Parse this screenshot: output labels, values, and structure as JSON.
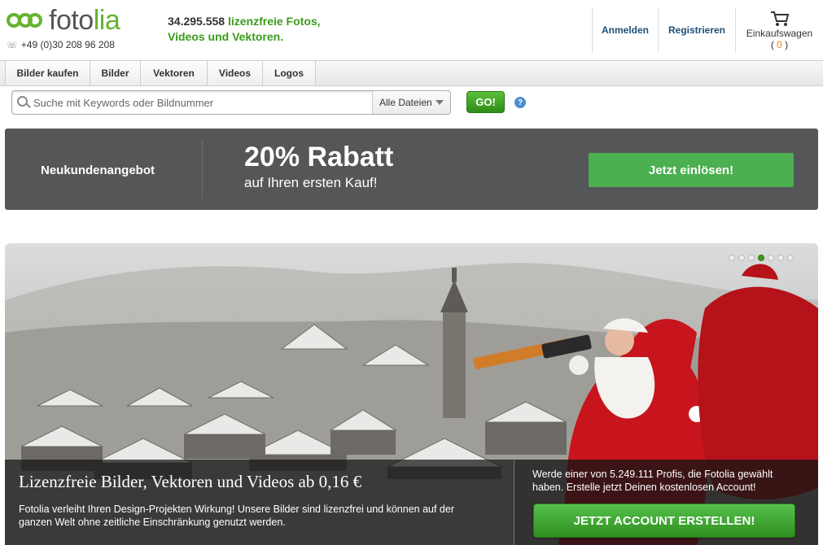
{
  "header": {
    "logo_part1": "foto",
    "logo_part2": "lia",
    "phone": "+49 (0)30 208 96 208",
    "tagline_count": "34.295.558",
    "tagline_line1_rest": "lizenzfreie Fotos,",
    "tagline_line2": "Videos und Vektoren.",
    "login": "Anmelden",
    "register": "Registrieren",
    "cart_label": "Einkaufswagen",
    "cart_count": "0"
  },
  "nav": {
    "tabs": [
      "Bilder kaufen",
      "Bilder",
      "Vektoren",
      "Videos",
      "Logos"
    ]
  },
  "search": {
    "placeholder": "Suche mit Keywords oder Bildnummer",
    "filter_selected": "Alle Dateien",
    "go_label": "GO!",
    "help_label": "?"
  },
  "promo": {
    "label": "Neukundenangebot",
    "headline": "20% Rabatt",
    "subline": "auf Ihren ersten Kauf!",
    "button": "Jetzt einlösen!"
  },
  "hero": {
    "slide_count": 7,
    "active_slide": 4,
    "title": "Lizenzfreie Bilder, Vektoren und Videos ab 0,16 €",
    "text": "Fotolia verleiht Ihren Design-Projekten Wirkung! Unsere Bilder sind lizenzfrei und können auf der ganzen Welt ohne zeitliche Einschränkung genutzt werden.",
    "signup_text": "Werde einer von 5.249.111 Profis, die Fotolia gewählt haben. Erstelle jetzt Deinen kostenlosen Account!",
    "signup_button": "JETZT ACCOUNT ERSTELLEN!"
  },
  "colors": {
    "brand_green": "#65b32e",
    "link_blue": "#1d4f7a",
    "promo_bg": "#555658",
    "cta_green": "#4caf50",
    "cart_count": "#e8820c"
  }
}
